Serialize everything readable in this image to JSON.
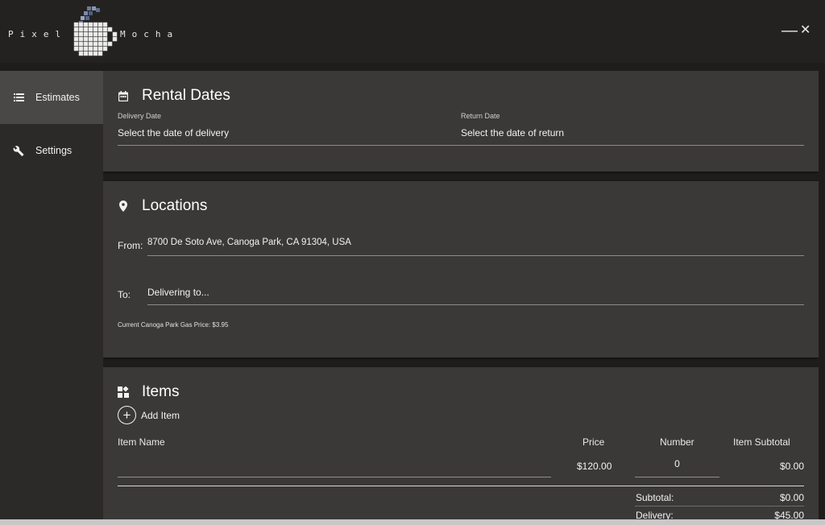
{
  "app": {
    "brand_left": "Pixel",
    "brand_right": "Mocha",
    "logo_icon": "pixel-coffee-mug-icon",
    "minimize_glyph": "—",
    "close_glyph": "✕"
  },
  "sidebar": {
    "items": [
      {
        "label": "Estimates",
        "icon": "list-icon",
        "active": true
      },
      {
        "label": "Settings",
        "icon": "wrench-icon",
        "active": false
      }
    ]
  },
  "rental_dates": {
    "title": "Rental Dates",
    "icon": "calendar-icon",
    "delivery": {
      "label": "Delivery Date",
      "placeholder": "Select the date of delivery"
    },
    "return": {
      "label": "Return Date",
      "placeholder": "Select the date of return"
    }
  },
  "locations": {
    "title": "Locations",
    "icon": "map-pin-icon",
    "from_label": "From:",
    "from_value": "8700 De Soto Ave, Canoga Park, CA 91304, USA",
    "to_label": "To:",
    "to_placeholder": "Delivering to...",
    "gas_price_note": "Current Canoga Park Gas Price: $3.95"
  },
  "items": {
    "title": "Items",
    "icon": "widgets-icon",
    "add_label": "Add Item",
    "columns": [
      "Item Name",
      "Price",
      "Number",
      "Item Subtotal"
    ],
    "rows": [
      {
        "name": "",
        "price": "$120.00",
        "number": "0",
        "subtotal": "$0.00"
      }
    ],
    "subtotal_label": "Subtotal:",
    "subtotal_value": "$0.00",
    "delivery_label": "Delivery:",
    "delivery_value": "$45.00"
  },
  "colors": {
    "titlebar": "#242221",
    "sidebar": "#2b2a29",
    "sidebar_active": "#4a4846",
    "card": "#3b3937",
    "background": "#1e1d1c"
  }
}
